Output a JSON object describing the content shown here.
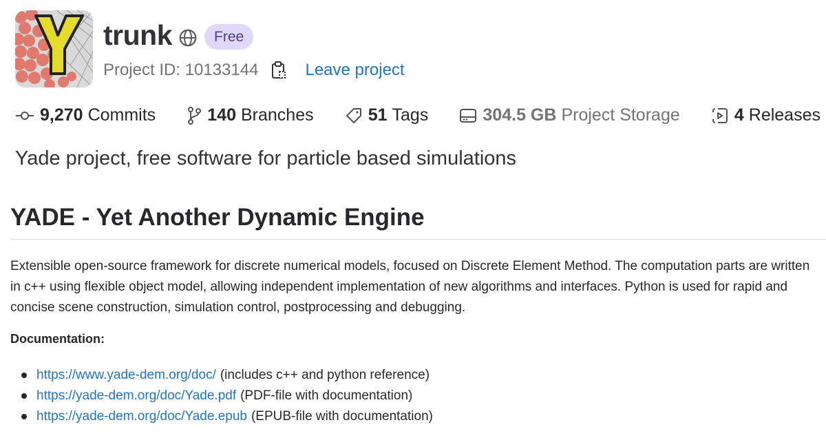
{
  "project": {
    "name": "trunk",
    "visibility_icon": "globe-icon",
    "plan_badge": "Free",
    "project_id_label": "Project ID: 10133144",
    "leave_label": "Leave project",
    "description": "Yade project, free software for particle based simulations"
  },
  "stats": [
    {
      "icon": "commit-icon",
      "count": "9,270",
      "label": "Commits"
    },
    {
      "icon": "branch-icon",
      "count": "140",
      "label": "Branches"
    },
    {
      "icon": "tag-icon",
      "count": "51",
      "label": "Tags"
    },
    {
      "icon": "storage-icon",
      "count": "304.5 GB",
      "label": "Project Storage"
    },
    {
      "icon": "release-icon",
      "count": "4",
      "label": "Releases"
    }
  ],
  "readme": {
    "heading": "YADE - Yet Another Dynamic Engine",
    "paragraph": "Extensible open-source framework for discrete numerical models, focused on Discrete Element Method. The computation parts are written in c++ using flexible object model, allowing independent implementation of new algorithms and interfaces. Python is used for rapid and concise scene construction, simulation control, postprocessing and debugging.",
    "doc_label": "Documentation:",
    "doc_links": [
      {
        "url": "https://www.yade-dem.org/doc/",
        "note": "(includes c++ and python reference)"
      },
      {
        "url": "https://yade-dem.org/doc/Yade.pdf",
        "note": "(PDF-file with documentation)"
      },
      {
        "url": "https://yade-dem.org/doc/Yade.epub",
        "note": "(EPUB-file with documentation)"
      }
    ]
  },
  "colors": {
    "link": "#1f75cb",
    "badge_bg": "#e1d8f9",
    "badge_text": "#4e3c8f"
  }
}
